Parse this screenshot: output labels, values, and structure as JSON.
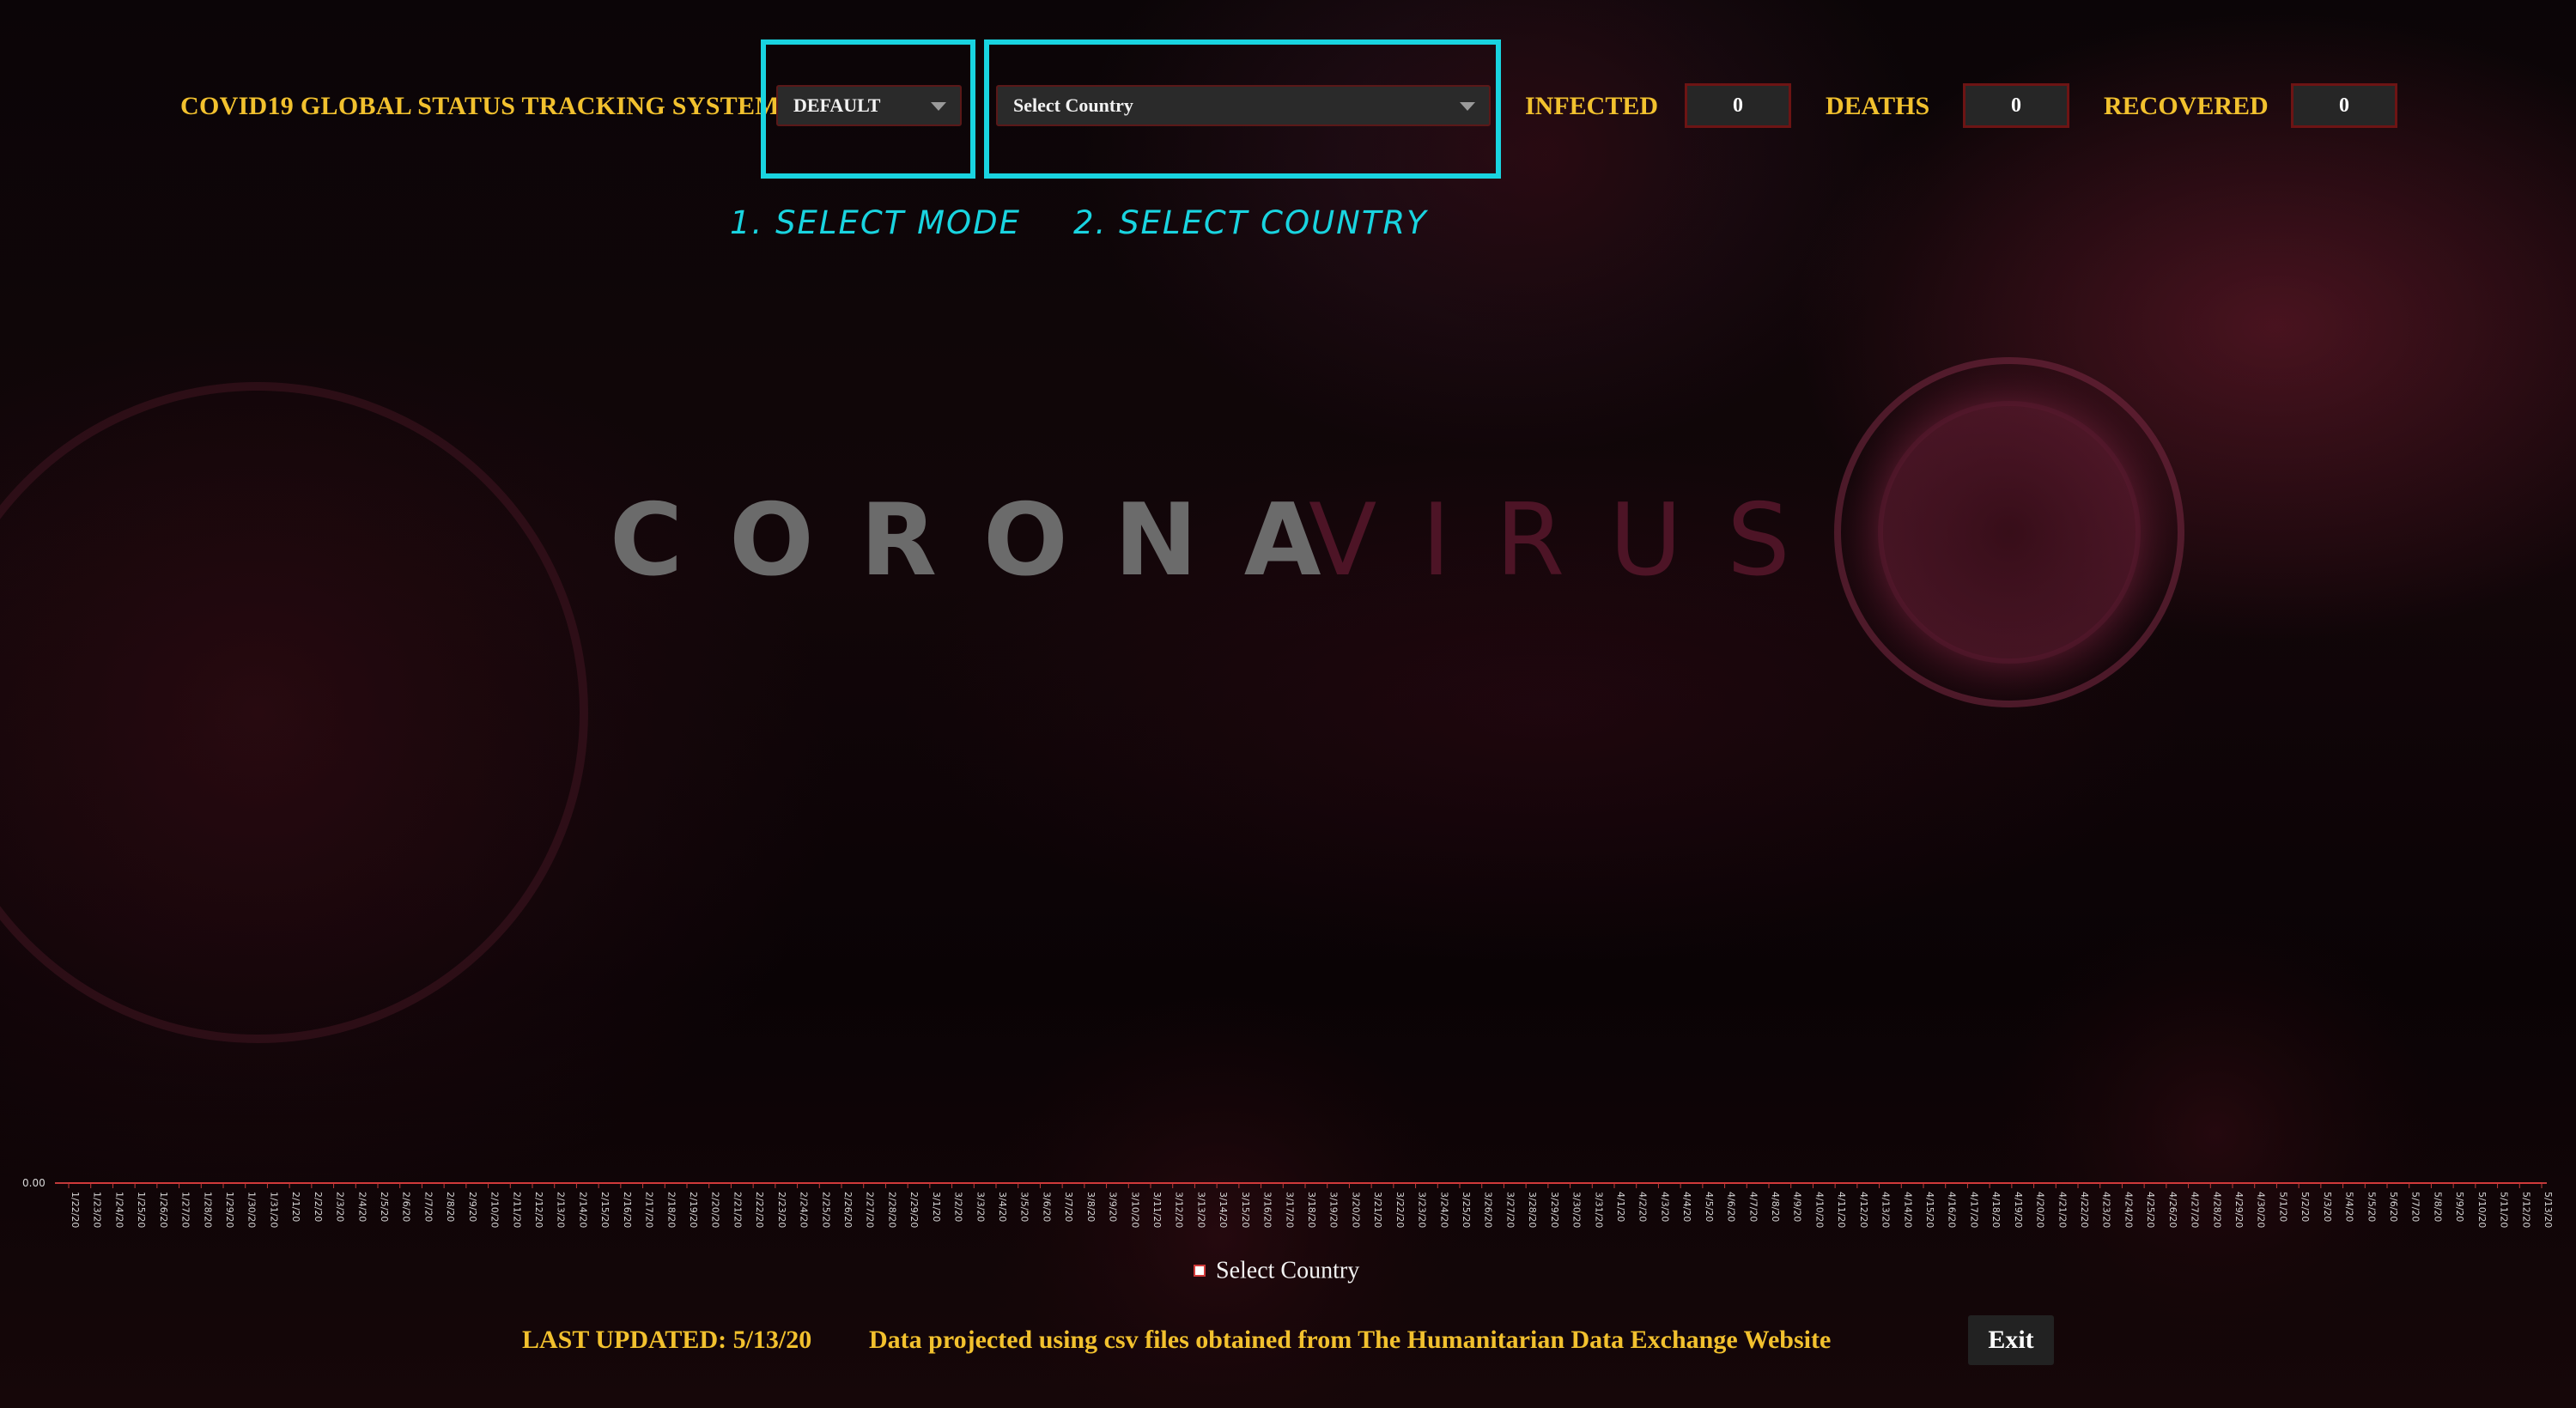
{
  "header": {
    "title": "COVID19 GLOBAL STATUS TRACKING SYSTEM",
    "mode_select": {
      "value": "DEFAULT"
    },
    "country_select": {
      "value": "Select Country"
    },
    "steps": {
      "step1": "1. SELECT MODE",
      "step2": "2. SELECT COUNTRY"
    },
    "stats": {
      "infected": {
        "label": "INFECTED",
        "value": "0"
      },
      "deaths": {
        "label": "DEATHS",
        "value": "0"
      },
      "recovered": {
        "label": "RECOVERED",
        "value": "0"
      }
    }
  },
  "banner": {
    "part1": "CORONA",
    "part2": "VIRUS"
  },
  "chart_data": {
    "type": "line",
    "title": "",
    "xlabel": "",
    "ylabel": "",
    "y_tick_label": "0.00",
    "x": [
      "1/22/20",
      "1/23/20",
      "1/24/20",
      "1/25/20",
      "1/26/20",
      "1/27/20",
      "1/28/20",
      "1/29/20",
      "1/30/20",
      "1/31/20",
      "2/1/20",
      "2/2/20",
      "2/3/20",
      "2/4/20",
      "2/5/20",
      "2/6/20",
      "2/7/20",
      "2/8/20",
      "2/9/20",
      "2/10/20",
      "2/11/20",
      "2/12/20",
      "2/13/20",
      "2/14/20",
      "2/15/20",
      "2/16/20",
      "2/17/20",
      "2/18/20",
      "2/19/20",
      "2/20/20",
      "2/21/20",
      "2/22/20",
      "2/23/20",
      "2/24/20",
      "2/25/20",
      "2/26/20",
      "2/27/20",
      "2/28/20",
      "2/29/20",
      "3/1/20",
      "3/2/20",
      "3/3/20",
      "3/4/20",
      "3/5/20",
      "3/6/20",
      "3/7/20",
      "3/8/20",
      "3/9/20",
      "3/10/20",
      "3/11/20",
      "3/12/20",
      "3/13/20",
      "3/14/20",
      "3/15/20",
      "3/16/20",
      "3/17/20",
      "3/18/20",
      "3/19/20",
      "3/20/20",
      "3/21/20",
      "3/22/20",
      "3/23/20",
      "3/24/20",
      "3/25/20",
      "3/26/20",
      "3/27/20",
      "3/28/20",
      "3/29/20",
      "3/30/20",
      "3/31/20",
      "4/1/20",
      "4/2/20",
      "4/3/20",
      "4/4/20",
      "4/5/20",
      "4/6/20",
      "4/7/20",
      "4/8/20",
      "4/9/20",
      "4/10/20",
      "4/11/20",
      "4/12/20",
      "4/13/20",
      "4/14/20",
      "4/15/20",
      "4/16/20",
      "4/17/20",
      "4/18/20",
      "4/19/20",
      "4/20/20",
      "4/21/20",
      "4/22/20",
      "4/23/20",
      "4/24/20",
      "4/25/20",
      "4/26/20",
      "4/27/20",
      "4/28/20",
      "4/29/20",
      "4/30/20",
      "5/1/20",
      "5/2/20",
      "5/3/20",
      "5/4/20",
      "5/5/20",
      "5/6/20",
      "5/7/20",
      "5/8/20",
      "5/9/20",
      "5/10/20",
      "5/11/20",
      "5/12/20",
      "5/13/20"
    ],
    "series": [
      {
        "name": "Select Country",
        "values": "all zero"
      }
    ],
    "ylim": [
      0,
      0
    ],
    "grid": false,
    "legend": "bottom-center",
    "colors": {
      "axis": "#c03a3a",
      "series": "#d03a3a"
    }
  },
  "footer": {
    "last_updated": "LAST UPDATED: 5/13/20",
    "source_note": "Data projected using csv files obtained from The Humanitarian Data Exchange Website",
    "exit_label": "Exit"
  },
  "colors": {
    "accent_yellow": "#f2c12e",
    "highlight_cyan": "#19d4e0",
    "stat_border": "#6d1414"
  }
}
